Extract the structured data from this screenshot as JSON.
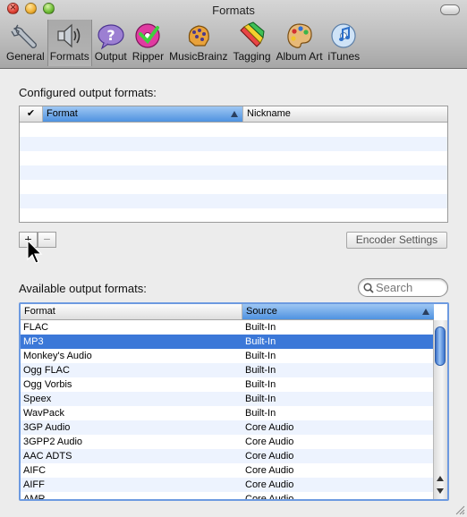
{
  "window": {
    "title": "Formats"
  },
  "toolbar": [
    {
      "label": "General",
      "icon": "wrench-icon",
      "active": false
    },
    {
      "label": "Formats",
      "icon": "speaker-icon",
      "active": true
    },
    {
      "label": "Output",
      "icon": "question-bubble-icon",
      "active": false
    },
    {
      "label": "Ripper",
      "icon": "cd-ripper-icon",
      "active": false
    },
    {
      "label": "MusicBrainz",
      "icon": "musicbrainz-brain-icon",
      "active": false
    },
    {
      "label": "Tagging",
      "icon": "crayons-icon",
      "active": false
    },
    {
      "label": "Album Art",
      "icon": "palette-icon",
      "active": false
    },
    {
      "label": "iTunes",
      "icon": "itunes-cd-icon",
      "active": false
    }
  ],
  "configured": {
    "label": "Configured output formats:",
    "columns": [
      "✔",
      "Format",
      "Nickname"
    ],
    "sorted_column": "Format",
    "rows": []
  },
  "buttons": {
    "add": "+",
    "remove": "−",
    "encoder_settings": "Encoder Settings"
  },
  "available": {
    "label": "Available output formats:",
    "search_placeholder": "Search",
    "columns": [
      "Format",
      "Source"
    ],
    "sorted_column": "Source",
    "selected_index": 1,
    "rows": [
      {
        "format": "FLAC",
        "source": "Built-In"
      },
      {
        "format": "MP3",
        "source": "Built-In"
      },
      {
        "format": "Monkey's Audio",
        "source": "Built-In"
      },
      {
        "format": "Ogg FLAC",
        "source": "Built-In"
      },
      {
        "format": "Ogg Vorbis",
        "source": "Built-In"
      },
      {
        "format": "Speex",
        "source": "Built-In"
      },
      {
        "format": "WavPack",
        "source": "Built-In"
      },
      {
        "format": "3GP Audio",
        "source": "Core Audio"
      },
      {
        "format": "3GPP2 Audio",
        "source": "Core Audio"
      },
      {
        "format": "AAC ADTS",
        "source": "Core Audio"
      },
      {
        "format": "AIFC",
        "source": "Core Audio"
      },
      {
        "format": "AIFF",
        "source": "Core Audio"
      },
      {
        "format": "AMR",
        "source": "Core Audio"
      }
    ]
  },
  "colors": {
    "selection": "#3b78d8",
    "stripe": "#edf3fe",
    "focus_ring": "#6d9ae0"
  }
}
